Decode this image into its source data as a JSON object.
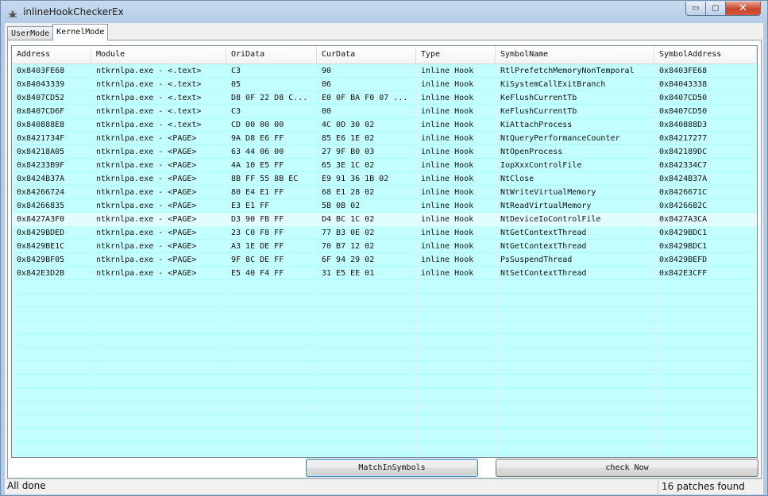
{
  "window": {
    "title": "inlineHookCheckerEx",
    "icon": "bug-icon",
    "controls": {
      "minimize": "▭",
      "maximize": "▢",
      "close": "✕"
    }
  },
  "tabs": [
    {
      "label": "UserMode",
      "active": false
    },
    {
      "label": "KernelMode",
      "active": true
    }
  ],
  "table": {
    "columns": [
      "Address",
      "Module",
      "OriData",
      "CurData",
      "Type",
      "SymbolName",
      "SymbolAddress"
    ],
    "rows": [
      [
        "0x8403FE68",
        "ntkrnlpa.exe - <.text>",
        "C3",
        "90",
        "inline Hook",
        "RtlPrefetchMemoryNonTemporal",
        "0x8403FE68"
      ],
      [
        "0x84043339",
        "ntkrnlpa.exe - <.text>",
        "05",
        "06",
        "inline Hook",
        "KiSystemCallExitBranch",
        "0x84043338"
      ],
      [
        "0x8407CD52",
        "ntkrnlpa.exe - <.text>",
        "D8 0F 22 D8 C...",
        "E0 0F BA F0 07 ...",
        "inline Hook",
        "KeFlushCurrentTb",
        "0x8407CD50"
      ],
      [
        "0x8407CD6F",
        "ntkrnlpa.exe - <.text>",
        "C3",
        "00",
        "inline Hook",
        "KeFlushCurrentTb",
        "0x8407CD50"
      ],
      [
        "0x840888E8",
        "ntkrnlpa.exe - <.text>",
        "CD 00 00 00",
        "4C 0D 30 02",
        "inline Hook",
        "KiAttachProcess",
        "0x840888D3"
      ],
      [
        "0x8421734F",
        "ntkrnlpa.exe - <PAGE>",
        "9A D8 E6 FF",
        "85 E6 1E 02",
        "inline Hook",
        "NtQueryPerformanceCounter",
        "0x84217277"
      ],
      [
        "0x84218A05",
        "ntkrnlpa.exe - <PAGE>",
        "63 44 06 00",
        "27 9F B0 03",
        "inline Hook",
        "NtOpenProcess",
        "0x842189DC"
      ],
      [
        "0x84233B9F",
        "ntkrnlpa.exe - <PAGE>",
        "4A 10 E5 FF",
        "65 3E 1C 02",
        "inline Hook",
        "IopXxxControlFile",
        "0x842334C7"
      ],
      [
        "0x8424B37A",
        "ntkrnlpa.exe - <PAGE>",
        "8B FF 55 8B EC",
        "E9 91 36 1B 02",
        "inline Hook",
        "NtClose",
        "0x8424B37A"
      ],
      [
        "0x84266724",
        "ntkrnlpa.exe - <PAGE>",
        "80 E4 E1 FF",
        "68 E1 28 02",
        "inline Hook",
        "NtWriteVirtualMemory",
        "0x8426671C"
      ],
      [
        "0x84266835",
        "ntkrnlpa.exe - <PAGE>",
        "E3 E1 FF",
        "5B 0B 02",
        "inline Hook",
        "NtReadVirtualMemory",
        "0x8426682C"
      ],
      [
        "0x8427A3F0",
        "ntkrnlpa.exe - <PAGE>",
        "D3 90 FB FF",
        "D4 BC 1C 02",
        "inline Hook",
        "NtDeviceIoControlFile",
        "0x8427A3CA"
      ],
      [
        "0x8429BDED",
        "ntkrnlpa.exe - <PAGE>",
        "23 C0 F8 FF",
        "77 B3 0E 02",
        "inline Hook",
        "NtGetContextThread",
        "0x8429BDC1"
      ],
      [
        "0x8429BE1C",
        "ntkrnlpa.exe - <PAGE>",
        "A3 1E DE FF",
        "70 B7 12 02",
        "inline Hook",
        "NtGetContextThread",
        "0x8429BDC1"
      ],
      [
        "0x8429BF05",
        "ntkrnlpa.exe - <PAGE>",
        "9F 8C DE FF",
        "6F 94 29 02",
        "inline Hook",
        "PsSuspendThread",
        "0x8429BEFD"
      ],
      [
        "0x842E3D2B",
        "ntkrnlpa.exe - <PAGE>",
        "E5 40 F4 FF",
        "31 E5 EE 01",
        "inline Hook",
        "NtSetContextThread",
        "0x842E3CFF"
      ]
    ],
    "highlighted_row": 11
  },
  "buttons": {
    "match": "MatchInSymbols",
    "check": "check Now"
  },
  "status": {
    "left": "All done",
    "right": "16 patches found"
  },
  "colors": {
    "row_fill": "#c4ffff",
    "row_separator": "#a9ffff",
    "close_button": "#c8452b"
  }
}
